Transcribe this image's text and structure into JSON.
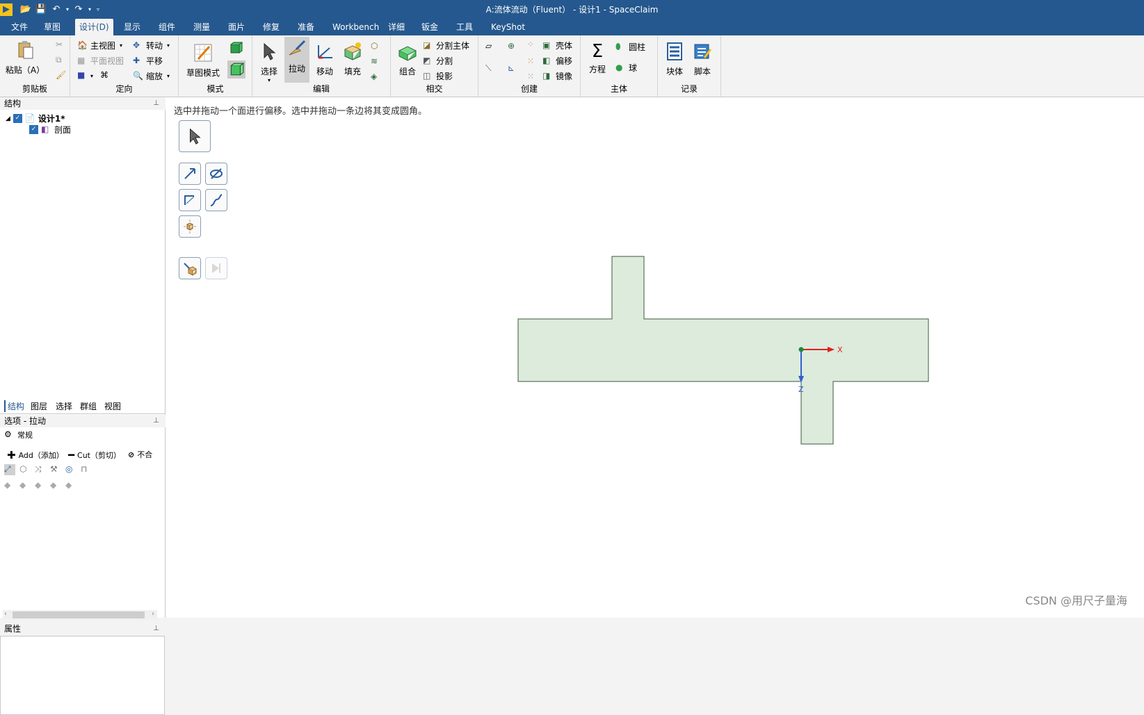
{
  "window": {
    "title": "A:流体流动（Fluent）  - 设计1 - SpaceClaim"
  },
  "menu": {
    "tabs": [
      "文件",
      "草图",
      "设计(D)",
      "显示",
      "组件",
      "测量",
      "面片",
      "修复",
      "准备",
      "Workbench",
      "详细",
      "钣金",
      "工具",
      "KeyShot"
    ],
    "active": "设计(D)"
  },
  "ribbon": {
    "clipboard": {
      "label": "剪贴板",
      "paste": "粘贴（A）"
    },
    "orient": {
      "label": "定向",
      "home_view": "主视图",
      "plan_view": "平面视图",
      "spin": "转动",
      "pan": "平移",
      "zoom": "缩放"
    },
    "mode": {
      "label": "模式",
      "sketch_mode": "草图模式"
    },
    "edit": {
      "label": "编辑",
      "select": "选择",
      "pull": "拉动",
      "move": "移动",
      "fill": "填充"
    },
    "intersect": {
      "label": "相交",
      "combine": "组合",
      "split_body": "分割主体",
      "split": "分割",
      "project": "投影"
    },
    "create": {
      "label": "创建",
      "shell": "壳体",
      "offset": "偏移",
      "mirror": "镜像"
    },
    "body": {
      "label": "主体",
      "equation": "方程",
      "cylinder": "圆柱",
      "sphere": "球"
    },
    "record": {
      "label": "记录",
      "block": "块体",
      "script": "脚本"
    }
  },
  "structure": {
    "title": "结构",
    "root": "设计1*",
    "child": "剖面"
  },
  "panel_tabs": [
    "结构",
    "图层",
    "选择",
    "群组",
    "视图"
  ],
  "options": {
    "title": "选项 - 拉动",
    "general": "常规",
    "add": "Add（添加）",
    "cut": "Cut（剪切）",
    "no_merge": "不合"
  },
  "properties": {
    "title": "属性"
  },
  "viewport": {
    "hint": "选中并拖动一个面进行偏移。选中并拖动一条边将其变成圆角。",
    "axis_x": "X",
    "axis_z": "Z"
  },
  "watermark": "CSDN @用尺子量海",
  "colors": {
    "accent": "#25588e",
    "shape_fill": "#dcebdc",
    "shape_stroke": "#3d5a3d",
    "axis_x": "#e02020",
    "axis_z": "#3060d0"
  }
}
